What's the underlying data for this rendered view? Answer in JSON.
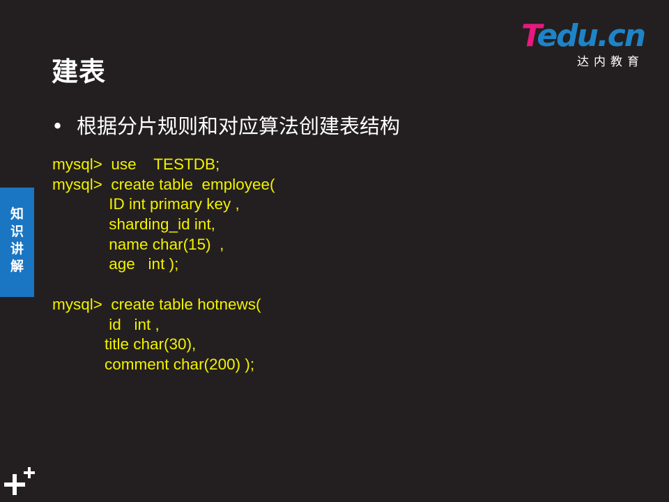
{
  "slide": {
    "title": "建表",
    "bullet_symbol": "•",
    "bullet": "根据分片规则和对应算法创建表结构",
    "code_lines": [
      "mysql>  use    TESTDB;",
      "mysql>  create table  employee(",
      "             ID int primary key ,",
      "             sharding_id int,",
      "             name char(15)  ,",
      "             age   int );",
      "",
      "mysql>  create table hotnews(",
      "             id   int ,",
      "            title char(30),",
      "            comment char(200) );"
    ]
  },
  "logo": {
    "t": "T",
    "rest": "edu.cn",
    "sub": "达内教育"
  },
  "side_tab": {
    "label": "知\n识\n讲\n解",
    "color": "#1a75c2"
  },
  "colors": {
    "background": "#231f20",
    "code": "#f2f200",
    "logo_pink": "#e6197d",
    "logo_blue": "#1e84c8"
  },
  "icons": {
    "corner": "plus-plus-icon"
  }
}
